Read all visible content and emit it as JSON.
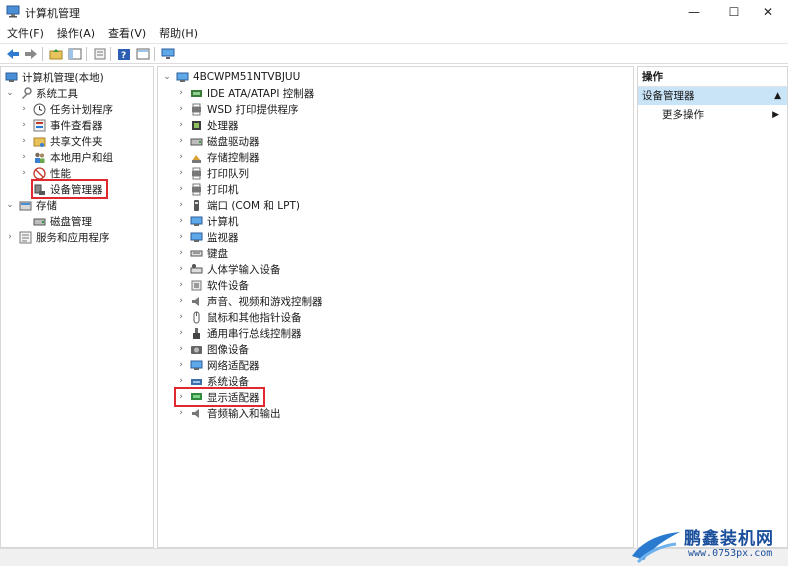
{
  "window": {
    "title": "计算机管理",
    "controls": {
      "minimize": "—",
      "maximize": "☐",
      "close": "✕"
    }
  },
  "menubar": [
    "文件(F)",
    "操作(A)",
    "查看(V)",
    "帮助(H)"
  ],
  "left_tree": {
    "root": "计算机管理(本地)",
    "system_tools": "系统工具",
    "items": [
      "任务计划程序",
      "事件查看器",
      "共享文件夹",
      "本地用户和组",
      "性能",
      "设备管理器"
    ],
    "storage": "存储",
    "disk_management": "磁盘管理",
    "services": "服务和应用程序"
  },
  "device_tree": {
    "computer": "4BCWPM51NTVBJUU",
    "categories": [
      "IDE ATA/ATAPI 控制器",
      "WSD 打印提供程序",
      "处理器",
      "磁盘驱动器",
      "存储控制器",
      "打印队列",
      "打印机",
      "端口 (COM 和 LPT)",
      "计算机",
      "监视器",
      "键盘",
      "人体学输入设备",
      "软件设备",
      "声音、视频和游戏控制器",
      "鼠标和其他指针设备",
      "通用串行总线控制器",
      "图像设备",
      "网络适配器",
      "系统设备",
      "显示适配器",
      "音频输入和输出"
    ]
  },
  "actions_pane": {
    "header": "操作",
    "selected": "设备管理器",
    "more": "更多操作"
  },
  "watermark": {
    "brand": "鹏鑫装机网",
    "url": "www.0753px.com"
  },
  "colors": {
    "highlight_box": "#e0282e",
    "selection": "#c9e3f7",
    "brand": "#1a4f9c"
  }
}
